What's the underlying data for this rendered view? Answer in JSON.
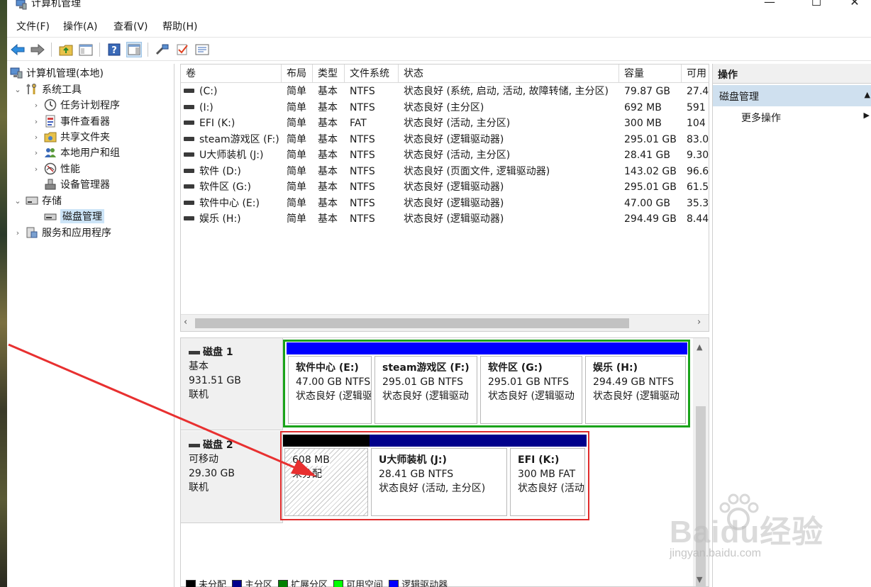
{
  "window": {
    "title": "计算机管理",
    "controls": {
      "minimize": "—",
      "maximize": "☐",
      "close": "✕"
    }
  },
  "menu": [
    {
      "label": "文件(F)"
    },
    {
      "label": "操作(A)"
    },
    {
      "label": "查看(V)"
    },
    {
      "label": "帮助(H)"
    }
  ],
  "toolbar": {
    "icons": [
      "back-arrow-icon",
      "forward-arrow-icon",
      "up-folder-icon",
      "show-hide-console-tree-icon",
      "help-icon",
      "action-pane-icon",
      "connect-icon",
      "check-icon",
      "properties-icon"
    ]
  },
  "tree": {
    "root": "计算机管理(本地)",
    "system_tools": "系统工具",
    "task_scheduler": "任务计划程序",
    "event_viewer": "事件查看器",
    "shared_folders": "共享文件夹",
    "local_users": "本地用户和组",
    "performance": "性能",
    "device_manager": "设备管理器",
    "storage": "存储",
    "disk_management": "磁盘管理",
    "services_apps": "服务和应用程序"
  },
  "volumes": {
    "columns": [
      "卷",
      "布局",
      "类型",
      "文件系统",
      "状态",
      "容量",
      "可用"
    ],
    "rows": [
      {
        "vol": "(C:)",
        "layout": "简单",
        "type": "基本",
        "fs": "NTFS",
        "status": "状态良好 (系统, 启动, 活动, 故障转储, 主分区)",
        "cap": "79.87 GB",
        "free": "27.4"
      },
      {
        "vol": "(I:)",
        "layout": "简单",
        "type": "基本",
        "fs": "NTFS",
        "status": "状态良好 (主分区)",
        "cap": "692 MB",
        "free": "591"
      },
      {
        "vol": "EFI (K:)",
        "layout": "简单",
        "type": "基本",
        "fs": "FAT",
        "status": "状态良好 (活动, 主分区)",
        "cap": "300 MB",
        "free": "104"
      },
      {
        "vol": "steam游戏区 (F:)",
        "layout": "简单",
        "type": "基本",
        "fs": "NTFS",
        "status": "状态良好 (逻辑驱动器)",
        "cap": "295.01 GB",
        "free": "83.0"
      },
      {
        "vol": "U大师装机 (J:)",
        "layout": "简单",
        "type": "基本",
        "fs": "NTFS",
        "status": "状态良好 (活动, 主分区)",
        "cap": "28.41 GB",
        "free": "9.30"
      },
      {
        "vol": "软件 (D:)",
        "layout": "简单",
        "type": "基本",
        "fs": "NTFS",
        "status": "状态良好 (页面文件, 逻辑驱动器)",
        "cap": "143.02 GB",
        "free": "96.6"
      },
      {
        "vol": "软件区 (G:)",
        "layout": "简单",
        "type": "基本",
        "fs": "NTFS",
        "status": "状态良好 (逻辑驱动器)",
        "cap": "295.01 GB",
        "free": "61.5"
      },
      {
        "vol": "软件中心 (E:)",
        "layout": "简单",
        "type": "基本",
        "fs": "NTFS",
        "status": "状态良好 (逻辑驱动器)",
        "cap": "47.00 GB",
        "free": "35.3"
      },
      {
        "vol": "娱乐 (H:)",
        "layout": "简单",
        "type": "基本",
        "fs": "NTFS",
        "status": "状态良好 (逻辑驱动器)",
        "cap": "294.49 GB",
        "free": "8.44"
      }
    ]
  },
  "disks": [
    {
      "name": "磁盘 1",
      "kind": "基本",
      "size": "931.51 GB",
      "state": "联机",
      "partitions": [
        {
          "name": "软件中心 (E:)",
          "size": "47.00 GB NTFS",
          "status": "状态良好 (逻辑驱",
          "color": "#0000ff"
        },
        {
          "name": "steam游戏区 (F:)",
          "size": "295.01 GB NTFS",
          "status": "状态良好 (逻辑驱动",
          "color": "#0000ff"
        },
        {
          "name": "软件区 (G:)",
          "size": "295.01 GB NTFS",
          "status": "状态良好 (逻辑驱动",
          "color": "#0000ff"
        },
        {
          "name": "娱乐 (H:)",
          "size": "294.49 GB NTFS",
          "status": "状态良好 (逻辑驱动",
          "color": "#0000ff"
        }
      ]
    },
    {
      "name": "磁盘 2",
      "kind": "可移动",
      "size": "29.30 GB",
      "state": "联机",
      "partitions": [
        {
          "name": "",
          "size": "608 MB",
          "status": "未分配",
          "color": "#000000"
        },
        {
          "name": "U大师装机 (J:)",
          "size": "28.41 GB NTFS",
          "status": "状态良好 (活动, 主分区)",
          "color": "#00008b"
        },
        {
          "name": "EFI (K:)",
          "size": "300 MB FAT",
          "status": "状态良好 (活动",
          "color": "#00008b"
        }
      ]
    }
  ],
  "legend": [
    {
      "label": "未分配",
      "color": "#000000"
    },
    {
      "label": "主分区",
      "color": "#00008b"
    },
    {
      "label": "扩展分区",
      "color": "#008000"
    },
    {
      "label": "可用空间",
      "color": "#00ff00"
    },
    {
      "label": "逻辑驱动器",
      "color": "#0000ff"
    }
  ],
  "actions": {
    "header": "操作",
    "section": "磁盘管理",
    "more": "更多操作"
  },
  "watermark": {
    "brand": "Baidu经验",
    "url": "jingyan.baidu.com"
  },
  "colors": {
    "selection": "#cce4f7",
    "highlight_red": "#e02c2c",
    "highlight_green": "#1aa31a",
    "action_section": "#cfe0ef"
  }
}
